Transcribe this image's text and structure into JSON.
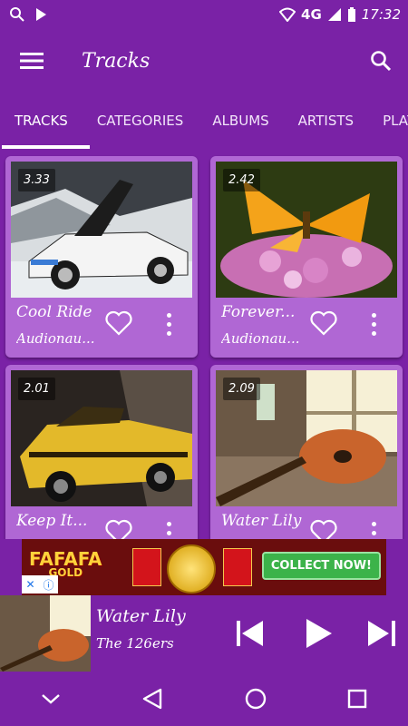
{
  "status_bar": {
    "network": "4G",
    "time": "17:32",
    "icons": [
      "search-icon",
      "play-store-icon",
      "wifi-icon",
      "signal-icon",
      "battery-icon"
    ]
  },
  "app_bar": {
    "title": "Tracks",
    "icons": [
      "menu-icon",
      "search-icon"
    ]
  },
  "tabs": [
    {
      "label": "TRACKS",
      "active": true
    },
    {
      "label": "CATEGORIES",
      "active": false
    },
    {
      "label": "ALBUMS",
      "active": false
    },
    {
      "label": "ARTISTS",
      "active": false
    },
    {
      "label": "PLAY",
      "active": false
    }
  ],
  "tracks": [
    {
      "name": "Cool Ride",
      "artist": "Audionau...",
      "duration": "3.33",
      "image": "sports-car-snow"
    },
    {
      "name": "Forever...",
      "artist": "Audionau...",
      "duration": "2.42",
      "image": "butterfly-flowers"
    },
    {
      "name": "Keep It...",
      "artist": "",
      "duration": "2.01",
      "image": "yellow-muscle-car"
    },
    {
      "name": "Water Lily",
      "artist": "",
      "duration": "2.09",
      "image": "guitar-window"
    }
  ],
  "ad": {
    "brand": "FAFAFA",
    "brand_sub": "GOLD",
    "cta": "COLLECT NOW!",
    "icons": [
      "close-icon",
      "info-icon"
    ]
  },
  "player": {
    "title": "Water Lily",
    "artist": "The 126ers",
    "icons": [
      "skip-previous-icon",
      "play-icon",
      "skip-next-icon"
    ]
  },
  "nav_bar": {
    "icons": [
      "collapse-icon",
      "back-icon",
      "home-icon",
      "recents-icon"
    ]
  },
  "colors": {
    "primary": "#7a22a6",
    "card": "#b067d4"
  }
}
